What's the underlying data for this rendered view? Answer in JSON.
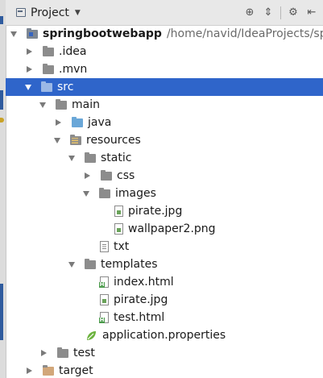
{
  "header": {
    "title": "Project"
  },
  "toolbar_icons": [
    "crosshair-icon",
    "collapse-all-icon",
    "gear-icon",
    "hide-icon"
  ],
  "tree": {
    "project_name": "springbootwebapp",
    "project_path": "/home/navid/IdeaProjects/spri",
    "items": [
      {
        "label": ".idea",
        "icon": "folder-icon"
      },
      {
        "label": ".mvn",
        "icon": "folder-icon"
      },
      {
        "label": "src",
        "icon": "folder-icon",
        "selected": true
      },
      {
        "label": "main",
        "icon": "folder-icon"
      },
      {
        "label": "java",
        "icon": "source-folder-icon"
      },
      {
        "label": "resources",
        "icon": "resources-folder-icon"
      },
      {
        "label": "static",
        "icon": "folder-icon"
      },
      {
        "label": "css",
        "icon": "folder-icon"
      },
      {
        "label": "images",
        "icon": "folder-icon"
      },
      {
        "label": "pirate.jpg",
        "icon": "image-file-icon"
      },
      {
        "label": "wallpaper2.png",
        "icon": "image-file-icon"
      },
      {
        "label": "txt",
        "icon": "text-file-icon"
      },
      {
        "label": "templates",
        "icon": "folder-icon"
      },
      {
        "label": "index.html",
        "icon": "html-file-icon"
      },
      {
        "label": "pirate.jpg",
        "icon": "image-file-icon"
      },
      {
        "label": "test.html",
        "icon": "html-file-icon"
      },
      {
        "label": "application.properties",
        "icon": "spring-leaf-icon"
      },
      {
        "label": "test",
        "icon": "folder-icon"
      },
      {
        "label": "target",
        "icon": "folder-icon"
      }
    ]
  },
  "colors": {
    "selection": "#2f65ca",
    "toolbar_bg": "#e8e8e8"
  }
}
